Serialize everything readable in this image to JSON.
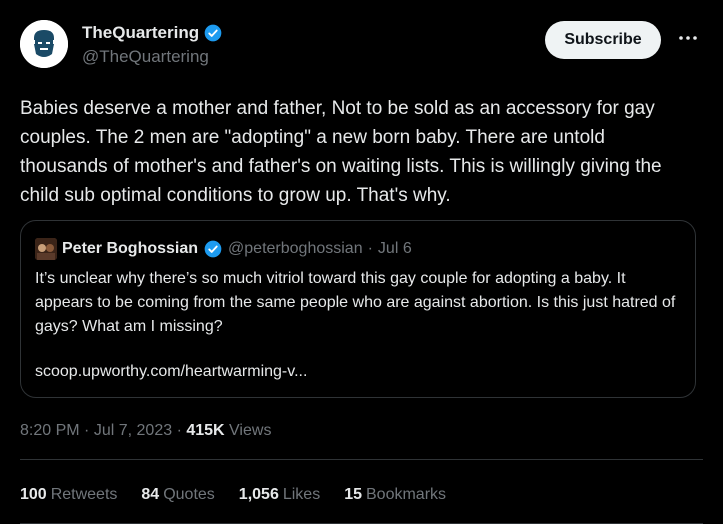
{
  "author": {
    "display_name": "TheQuartering",
    "handle": "@TheQuartering",
    "verified_color": "#1d9bf0"
  },
  "actions": {
    "subscribe_label": "Subscribe",
    "more_icon": "more-icon"
  },
  "tweet": {
    "text": "Babies deserve a mother and father, Not to be sold as an accessory for gay couples. The 2 men are \"adopting\" a new born baby. There are untold thousands of mother's and father's on waiting lists. This is willingly giving the child sub optimal conditions to grow up. That's why."
  },
  "quote": {
    "display_name": "Peter Boghossian",
    "handle": "@peterboghossian",
    "separator": "·",
    "date": "Jul 6",
    "text": "It’s unclear why there’s so much vitriol toward this gay couple for adopting a baby. It appears to be coming from the same people who are against abortion. Is this just hatred of gays? What am I missing?",
    "link": "scoop.upworthy.com/heartwarming-v..."
  },
  "meta": {
    "time": "8:20 PM",
    "separator": "·",
    "date": "Jul 7, 2023",
    "views_count": "415K",
    "views_label": "Views"
  },
  "stats": [
    {
      "count": "100",
      "label": "Retweets"
    },
    {
      "count": "84",
      "label": "Quotes"
    },
    {
      "count": "1,056",
      "label": "Likes"
    },
    {
      "count": "15",
      "label": "Bookmarks"
    }
  ]
}
